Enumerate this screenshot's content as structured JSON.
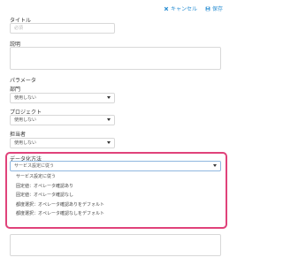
{
  "toolbar": {
    "cancel_label": "キャンセル",
    "save_label": "保存"
  },
  "title_field": {
    "label": "タイトル",
    "placeholder": "必須"
  },
  "description_field": {
    "label": "説明"
  },
  "parameters": {
    "heading": "パラメータ",
    "department": {
      "label": "部門",
      "value": "使用しない"
    },
    "project": {
      "label": "プロジェクト",
      "value": "使用しない"
    },
    "owner": {
      "label": "担当者",
      "value": "使用しない"
    }
  },
  "data_method": {
    "label": "データ化方法",
    "value": "サービス設定に従う",
    "options": [
      "サービス設定に従う",
      "固定値：オペレータ確認あり",
      "固定値：オペレータ確認なし",
      "都度選択：オペレータ確認ありをデフォルト",
      "都度選択：オペレータ確認なしをデフォルト"
    ]
  },
  "colors": {
    "accent": "#2b8fd3",
    "highlight": "#e0427a"
  }
}
